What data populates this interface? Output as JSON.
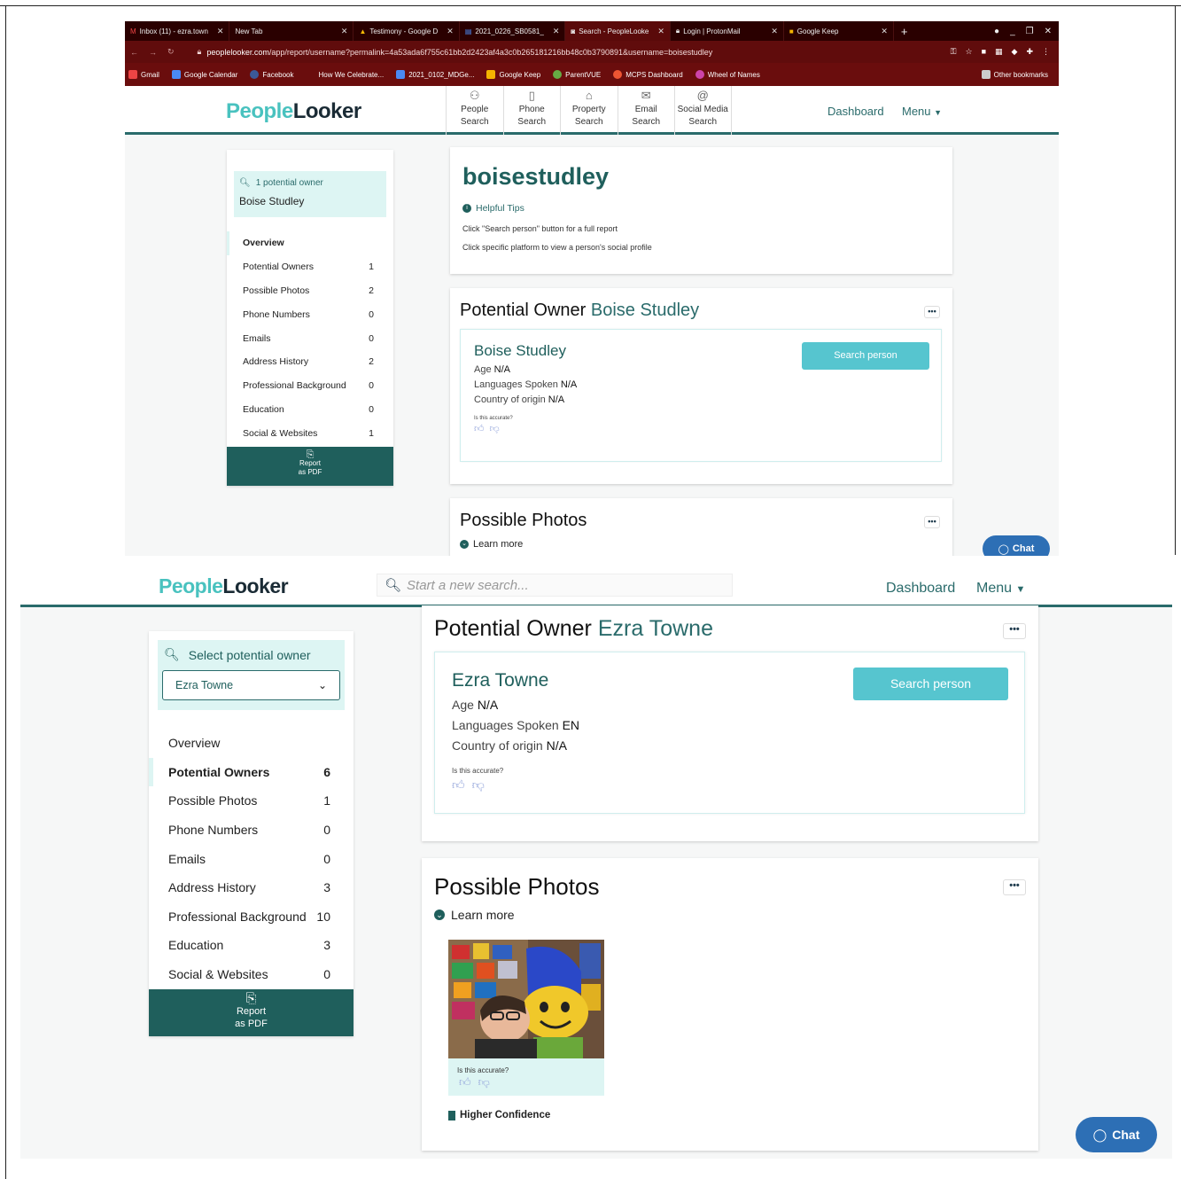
{
  "browser": {
    "tabs": [
      {
        "label": "Inbox (11) - ezra.town",
        "icon": "gmail-icon"
      },
      {
        "label": "New Tab",
        "icon": ""
      },
      {
        "label": "Testimony - Google D",
        "icon": "drive-icon"
      },
      {
        "label": "2021_0226_SB0581_",
        "icon": "docs-icon"
      },
      {
        "label": "Search - PeopleLooke",
        "icon": "peoplelooker-icon"
      },
      {
        "label": "Login | ProtonMail",
        "icon": "lock-icon"
      },
      {
        "label": "Google Keep",
        "icon": "keep-icon"
      }
    ],
    "url_domain": "peoplelooker.com",
    "url_path": "/app/report/username?permalink=4a53ada6f755c61bb2d2423af4a3c0b265181216bb48c0b3790891&username=boisestudley",
    "bookmarks": [
      {
        "label": "Gmail",
        "color": "#e44"
      },
      {
        "label": "Google Calendar",
        "color": "#4a8af4"
      },
      {
        "label": "Facebook",
        "color": "#3b5998"
      },
      {
        "label": "How We Celebrate...",
        "color": ""
      },
      {
        "label": "2021_0102_MDGe...",
        "color": "#4a8af4"
      },
      {
        "label": "Google Keep",
        "color": "#f4b400"
      },
      {
        "label": "ParentVUE",
        "color": "#6a4"
      },
      {
        "label": "MCPS Dashboard",
        "color": "#e53"
      },
      {
        "label": "Wheel of Names",
        "color": "#c4a"
      }
    ],
    "other_bookmarks": "Other bookmarks"
  },
  "shot1": {
    "logo_a": "People",
    "logo_b": "Looker",
    "nav_tabs": [
      {
        "line1": "People",
        "line2": "Search",
        "icon": "person-icon"
      },
      {
        "line1": "Phone",
        "line2": "Search",
        "icon": "phone-icon"
      },
      {
        "line1": "Property",
        "line2": "Search",
        "icon": "house-icon"
      },
      {
        "line1": "Email",
        "line2": "Search",
        "icon": "envelope-icon"
      },
      {
        "line1": "Social Media",
        "line2": "Search",
        "icon": "at-icon"
      }
    ],
    "dashboard": "Dashboard",
    "menu": "Menu",
    "owner_label": "1 potential owner",
    "owner_name": "Boise Studley",
    "sidebar": [
      {
        "label": "Overview",
        "count": ""
      },
      {
        "label": "Potential Owners",
        "count": "1"
      },
      {
        "label": "Possible Photos",
        "count": "2"
      },
      {
        "label": "Phone Numbers",
        "count": "0"
      },
      {
        "label": "Emails",
        "count": "0"
      },
      {
        "label": "Address History",
        "count": "2"
      },
      {
        "label": "Professional Background",
        "count": "0"
      },
      {
        "label": "Education",
        "count": "0"
      },
      {
        "label": "Social & Websites",
        "count": "1"
      }
    ],
    "pdf_line1": "Report",
    "pdf_line2": "as PDF",
    "username": "boisestudley",
    "helpful_tips": "Helpful Tips",
    "tip1": "Click \"Search person\" button for a full report",
    "tip2": "Click specific platform to view a person's social profile",
    "owner_card_title": "Potential Owner",
    "owner_card_name": "Boise Studley",
    "person_name": "Boise Studley",
    "age_label": "Age",
    "age": "N/A",
    "lang_label": "Languages Spoken",
    "lang": "N/A",
    "country_label": "Country of origin",
    "country": "N/A",
    "accurate": "Is this accurate?",
    "search_person": "Search person",
    "photos_title": "Possible Photos",
    "learn_more": "Learn more",
    "chat": "Chat"
  },
  "shot2": {
    "logo_a": "People",
    "logo_b": "Looker",
    "search_placeholder": "Start a new search...",
    "dashboard": "Dashboard",
    "menu": "Menu",
    "owner_label": "Select potential owner",
    "selected_owner": "Ezra Towne",
    "sidebar": [
      {
        "label": "Overview",
        "count": ""
      },
      {
        "label": "Potential Owners",
        "count": "6"
      },
      {
        "label": "Possible Photos",
        "count": "1"
      },
      {
        "label": "Phone Numbers",
        "count": "0"
      },
      {
        "label": "Emails",
        "count": "0"
      },
      {
        "label": "Address History",
        "count": "3"
      },
      {
        "label": "Professional Background",
        "count": "10"
      },
      {
        "label": "Education",
        "count": "3"
      },
      {
        "label": "Social & Websites",
        "count": "0"
      }
    ],
    "pdf_line1": "Report",
    "pdf_line2": "as PDF",
    "owner_card_title": "Potential Owner",
    "owner_card_name": "Ezra Towne",
    "person_name": "Ezra Towne",
    "age_label": "Age",
    "age": "N/A",
    "lang_label": "Languages Spoken",
    "lang": "EN",
    "country_label": "Country of origin",
    "country": "N/A",
    "accurate": "Is this accurate?",
    "search_person": "Search person",
    "photos_title": "Possible Photos",
    "learn_more": "Learn more",
    "photo_accurate": "Is this accurate?",
    "confidence": "Higher Confidence",
    "chat": "Chat"
  }
}
